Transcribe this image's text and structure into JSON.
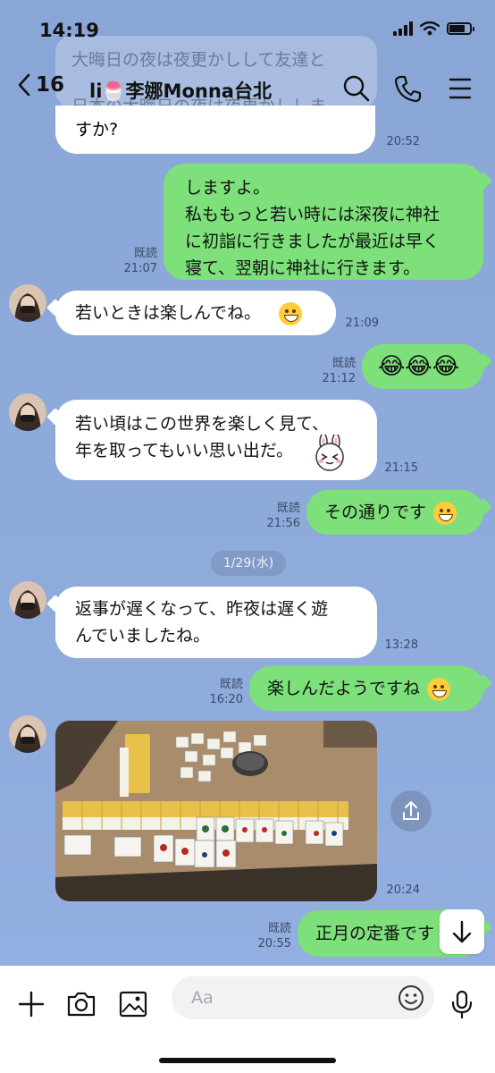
{
  "status_bar": {
    "time": "14:19"
  },
  "header": {
    "back_count": "16",
    "title": "li🍧李娜Monna台北",
    "icons": [
      "search-icon",
      "phone-icon",
      "menu-icon"
    ]
  },
  "notification": {
    "line1": "大晦日の夜は夜更かしして友達と",
    "line2": "日本の大晦日の夜は夜更かししま"
  },
  "messages": [
    {
      "side": "left",
      "lines": [
        "すか?"
      ],
      "time": "20:52"
    },
    {
      "side": "right",
      "lines": [
        "しますよ。",
        "私ももっと若い時には深夜に神社",
        "に初詣に行きましたが最近は早く",
        "寝て、翌朝に神社に行きます。"
      ],
      "read": "既読",
      "time": "21:07"
    },
    {
      "side": "left",
      "lines": [
        "若いときは楽しんでね。"
      ],
      "emoji": "grin-emoji",
      "time": "21:09"
    },
    {
      "side": "right",
      "lines": [
        "😂😂😂"
      ],
      "read": "既読",
      "time": "21:12"
    },
    {
      "side": "left",
      "lines": [
        "若い頃はこの世界を楽しく見て、",
        "年を取ってもいい思い出だ。"
      ],
      "sticker": "rabbit-sticker-icon",
      "time": "21:15"
    },
    {
      "side": "right",
      "lines": [
        "その通りです"
      ],
      "emoji": "grin-emoji",
      "read": "既読",
      "time": "21:56"
    },
    {
      "side": "left",
      "lines": [
        "返事が遅くなって、昨夜は遅く遊",
        "んでいましたね。"
      ],
      "time": "13:28"
    },
    {
      "side": "right",
      "lines": [
        "楽しんだようですね"
      ],
      "emoji": "hand-over-mouth-emoji",
      "read": "既読",
      "time": "16:20"
    },
    {
      "side": "left",
      "type": "photo",
      "subject": "mahjong-tiles-photo",
      "time": "20:24"
    },
    {
      "side": "right",
      "lines": [
        "正月の定番です"
      ],
      "read": "既読",
      "time": "20:55"
    }
  ],
  "date_separator": "1/29(水)",
  "input": {
    "placeholder": "Aa"
  },
  "colors": {
    "chat_bg": "#8da8d7",
    "my_bubble": "#7de07a",
    "their_bubble": "#ffffff"
  }
}
